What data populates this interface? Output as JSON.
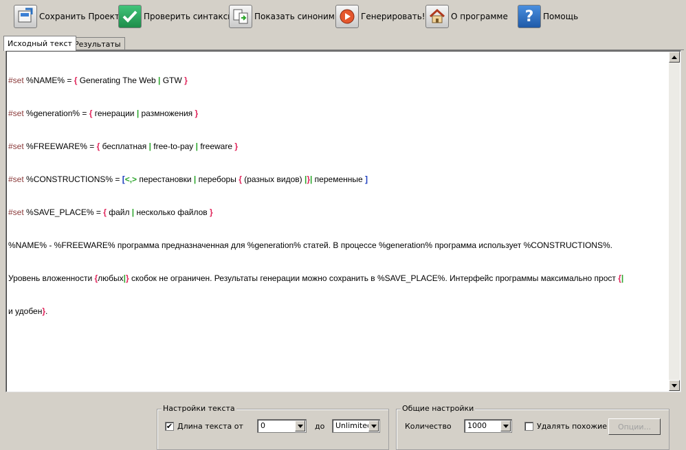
{
  "toolbar": {
    "save_label": "Сохранить Проект",
    "check_label": "Проверить синтаксис",
    "synonyms_label": "Показать синонимы",
    "generate_label": "Генерировать!",
    "about_label": "О программе",
    "help_label": "Помощь",
    "help_glyph": "?"
  },
  "tabs": [
    {
      "label": "Исходный текст"
    },
    {
      "label": "Результаты"
    }
  ],
  "editor": {
    "l1": {
      "kw": "#set",
      "a": " %NAME% = ",
      "b1": "{",
      "t1": " Generating The Web ",
      "p1": "|",
      "t2": " GTW ",
      "b2": "}"
    },
    "l2": {
      "kw": "#set",
      "a": " %generation% = ",
      "b1": "{",
      "t1": " генерации ",
      "p1": "|",
      "t2": " размножения ",
      "b2": "}"
    },
    "l3": {
      "kw": "#set",
      "a": " %FREEWARE% = ",
      "b1": "{",
      "t1": " бесплатная ",
      "p1": "|",
      "t2": " free-to-pay ",
      "p2": "|",
      "t3": " freeware ",
      "b2": "}"
    },
    "l4": {
      "kw": "#set",
      "a": " %CONSTRUCTIONS% = ",
      "s1": "[",
      "g1": "<,>",
      "t1": " перестановки ",
      "p1": "|",
      "t2": " переборы ",
      "b1": "{",
      "t3": " (разных видов) ",
      "p2": "|",
      "b2": "}",
      "p3": "|",
      "t4": " переменные ",
      "s2": "]"
    },
    "l5": {
      "kw": "#set",
      "a": " %SAVE_PLACE% = ",
      "b1": "{",
      "t1": " файл ",
      "p1": "|",
      "t2": " несколько  файлов ",
      "b2": "}"
    },
    "l6": "%NAME% - %FREEWARE% программа предназначенная для %generation% статей. В процессе %generation% программа использует %CONSTRUCTIONS%.",
    "l7": {
      "a": "Уровень вложенности ",
      "b1": "{",
      "t1": "любых",
      "p1": "|",
      "b2": "}",
      "t2": " скобок не ограничен. Результаты генерации можно сохранить в %SAVE_PLACE%. Интерфейс программы максимально прост ",
      "b3": "{",
      "p2": "|"
    },
    "l8": {
      "a": "и удобен",
      "b1": "}",
      "t1": "."
    }
  },
  "text_settings": {
    "title": "Настройки текста",
    "length_label": "Длина текста от",
    "checked": true,
    "from_value": "0",
    "to_label": "до",
    "to_value": "Unlimited"
  },
  "general_settings": {
    "title": "Общие настройки",
    "count_label": "Количество",
    "count_value": "1000",
    "remove_similar_label": "Удалять похожие",
    "remove_similar_checked": false,
    "options_button": "Опции..."
  },
  "colors": {
    "keyword": "#8b3a3a",
    "brace": "#e0245a",
    "pipe": "#2aa52a",
    "square": "#1e3fbf",
    "background": "#d4d0c8"
  },
  "icons": {
    "save": "save-project-icon",
    "check": "check-syntax-icon",
    "synonyms": "synonyms-icon",
    "generate": "generate-icon",
    "about": "home-icon",
    "help": "help-icon"
  }
}
